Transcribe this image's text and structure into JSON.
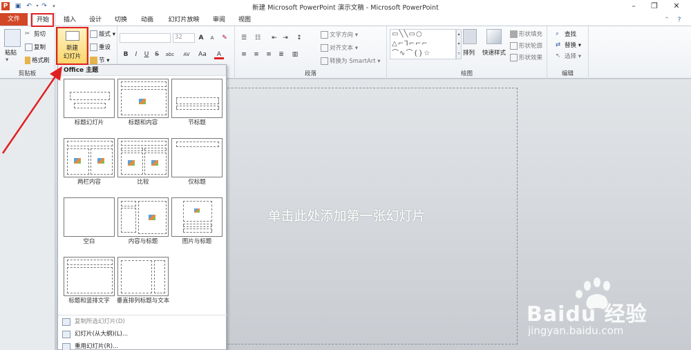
{
  "window": {
    "title": "新建 Microsoft PowerPoint 演示文稿 - Microsoft PowerPoint",
    "qat": [
      "ppt-logo-icon",
      "save-icon",
      "undo-icon",
      "redo-icon",
      "customize-icon"
    ],
    "controls": [
      "minimize",
      "restore",
      "close"
    ]
  },
  "tabs": {
    "file": "文件",
    "home": "开始",
    "insert": "插入",
    "design": "设计",
    "transitions": "切换",
    "animations": "动画",
    "slideshow": "幻灯片放映",
    "review": "审阅",
    "view": "视图"
  },
  "ribbon": {
    "clipboard": {
      "label": "剪贴板",
      "paste": "粘贴",
      "cut": "剪切",
      "copy": "复制",
      "format_painter": "格式刷"
    },
    "slides": {
      "new_slide_line1": "新建",
      "new_slide_line2": "幻灯片",
      "layout": "版式",
      "reset": "重设",
      "section": "节"
    },
    "font": {
      "size": "32",
      "bold": "B",
      "italic": "I",
      "underline": "U",
      "strike": "S",
      "shadow": "abc",
      "spacing": "AV",
      "case": "Aa",
      "color": "A",
      "grow": "A",
      "shrink": "A"
    },
    "paragraph": {
      "label": "段落",
      "text_direction": "文字方向",
      "align_text": "对齐文本",
      "convert_smartart": "转换为 SmartArt"
    },
    "drawing": {
      "label": "绘图",
      "arrange": "排列",
      "quick_styles": "快速样式",
      "shape_fill": "形状填充",
      "shape_outline": "形状轮廓",
      "shape_effects": "形状效果"
    },
    "editing": {
      "label": "编辑",
      "find": "查找",
      "replace": "替换",
      "select": "选择"
    }
  },
  "gallery": {
    "header": "Office 主题",
    "layouts": [
      {
        "name": "标题幻灯片"
      },
      {
        "name": "标题和内容"
      },
      {
        "name": "节标题"
      },
      {
        "name": "两栏内容"
      },
      {
        "name": "比较"
      },
      {
        "name": "仅标题"
      },
      {
        "name": "空白"
      },
      {
        "name": "内容与标题"
      },
      {
        "name": "图片与标题"
      },
      {
        "name": "标题和竖排文字"
      },
      {
        "name": "垂直排列标题与文本"
      }
    ],
    "menu": [
      {
        "label": "复制所选幻灯片(D)",
        "enabled": false
      },
      {
        "label": "幻灯片(从大纲)(L)...",
        "enabled": true
      },
      {
        "label": "重用幻灯片(R)...",
        "enabled": true
      }
    ]
  },
  "slide": {
    "prompt": "单击此处添加第一张幻灯片"
  },
  "watermark": {
    "brand": "Baidu 经验",
    "url": "jingyan.baidu.com"
  },
  "colors": {
    "file_tab": "#d24726",
    "annotation": "#e02020",
    "accent_new_slide": "#fbd66a"
  }
}
